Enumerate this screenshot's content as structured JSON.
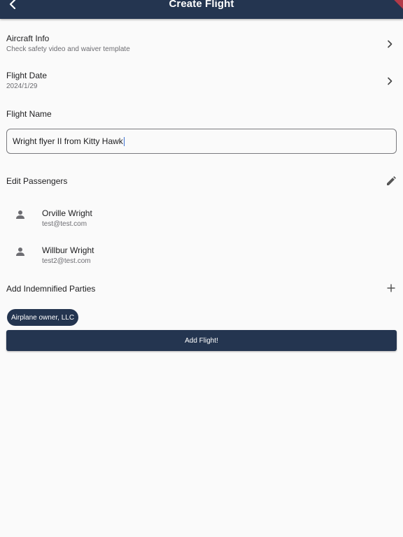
{
  "appbar": {
    "title": "Create Flight",
    "back_icon": "chevron-left-icon"
  },
  "aircraft_info": {
    "title": "Aircraft Info",
    "subtitle": "Check safety video and waiver template",
    "icon": "chevron-right-icon"
  },
  "flight_date": {
    "title": "Flight Date",
    "value": "2024/1/29",
    "icon": "chevron-right-icon"
  },
  "flight_name": {
    "label": "Flight Name",
    "value": "Wright flyer II from Kitty Hawk"
  },
  "passengers": {
    "title": "Edit Passengers",
    "edit_icon": "pencil-icon",
    "items": [
      {
        "name": "Orville Wright",
        "email": "test@test.com",
        "icon": "person-icon"
      },
      {
        "name": "Willbur Wright",
        "email": "test2@test.com",
        "icon": "person-icon"
      }
    ]
  },
  "indemnified": {
    "title": "Add Indemnified Parties",
    "add_icon": "plus-icon",
    "chips": [
      "Airplane owner, LLC"
    ]
  },
  "submit": {
    "label": "Add Flight!"
  },
  "colors": {
    "primary": "#243550",
    "background": "#fafafa",
    "accent_banner": "#b23a48"
  }
}
